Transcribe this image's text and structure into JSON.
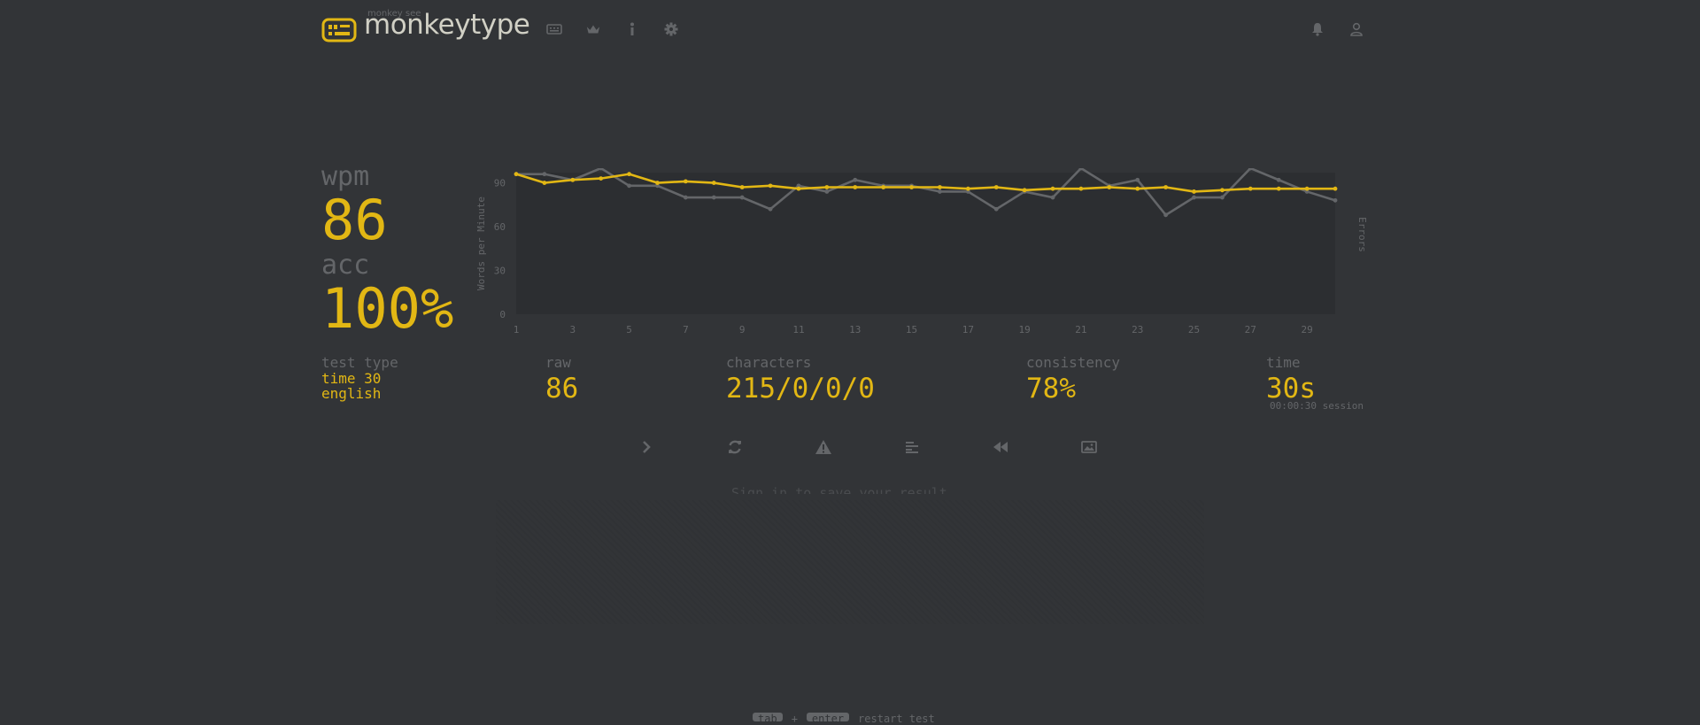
{
  "header": {
    "logo_sub": "monkey see",
    "logo_text": "monkeytype",
    "nav_icons": [
      "keyboard-icon",
      "crown-icon",
      "info-icon",
      "gear-icon"
    ],
    "right_icons": [
      "bell-icon",
      "user-icon"
    ]
  },
  "result": {
    "wpm_label": "wpm",
    "wpm": "86",
    "acc_label": "acc",
    "acc": "100%"
  },
  "stats": {
    "test_type_label": "test type",
    "test_type_mode": "time 30",
    "test_type_lang": "english",
    "raw_label": "raw",
    "raw": "86",
    "characters_label": "characters",
    "characters": "215/0/0/0",
    "consistency_label": "consistency",
    "consistency": "78%",
    "time_label": "time",
    "time": "30s",
    "session": "00:00:30 session"
  },
  "actions": [
    "next-test",
    "restart-test",
    "report-quote",
    "word-history",
    "replay",
    "save-screenshot"
  ],
  "colors": {
    "bg": "#323437",
    "accent": "#e2b714",
    "sub": "#646669",
    "text": "#d1d0c5"
  },
  "signin_note": "Sign in to save your result",
  "footer": {
    "key1": "tab",
    "plus": "+",
    "key2": "enter",
    "label": "restart test"
  },
  "chart_data": {
    "type": "line",
    "ylabel": "Words per Minute",
    "y2label": "Errors",
    "x": [
      1,
      2,
      3,
      4,
      5,
      6,
      7,
      8,
      9,
      10,
      11,
      12,
      13,
      14,
      15,
      16,
      17,
      18,
      19,
      20,
      21,
      22,
      23,
      24,
      25,
      26,
      27,
      28,
      29,
      30
    ],
    "xticks": [
      1,
      3,
      5,
      7,
      9,
      11,
      13,
      15,
      17,
      19,
      21,
      23,
      25,
      27,
      29
    ],
    "yticks": [
      0,
      30,
      60,
      90
    ],
    "ylim": [
      0,
      97
    ],
    "series": [
      {
        "name": "wpm",
        "color": "#e2b714",
        "values": [
          96,
          90,
          92,
          93,
          96,
          90,
          91,
          90,
          87,
          88,
          86,
          87,
          87,
          87,
          87,
          87,
          86,
          87,
          85,
          86,
          86,
          87,
          86,
          87,
          84,
          85,
          86,
          86,
          86,
          86
        ]
      },
      {
        "name": "raw",
        "color": "#646669",
        "values": [
          96,
          96,
          92,
          100,
          88,
          88,
          80,
          80,
          80,
          72,
          88,
          84,
          92,
          88,
          88,
          84,
          84,
          72,
          84,
          80,
          100,
          88,
          92,
          68,
          80,
          80,
          100,
          92,
          84,
          78
        ]
      }
    ]
  }
}
